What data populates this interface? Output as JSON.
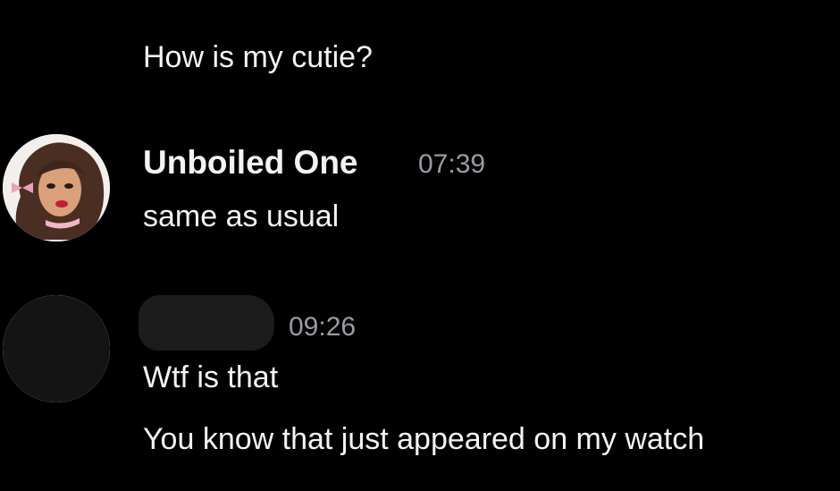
{
  "messages": [
    {
      "continuation": true,
      "text": "How is my cutie?"
    },
    {
      "author": "Unboiled One",
      "time": "07:39",
      "avatar": "profile-picture-doll",
      "lines": [
        "same as usual"
      ]
    },
    {
      "author_redacted": true,
      "time": "09:26",
      "avatar": "profile-picture-redacted",
      "lines": [
        "Wtf is that",
        "You know that just appeared on my watch"
      ]
    }
  ],
  "colors": {
    "background": "#000000",
    "text": "#f2f3f5",
    "timestamp": "#9a9ba3",
    "redaction": "#1c1c1c"
  }
}
